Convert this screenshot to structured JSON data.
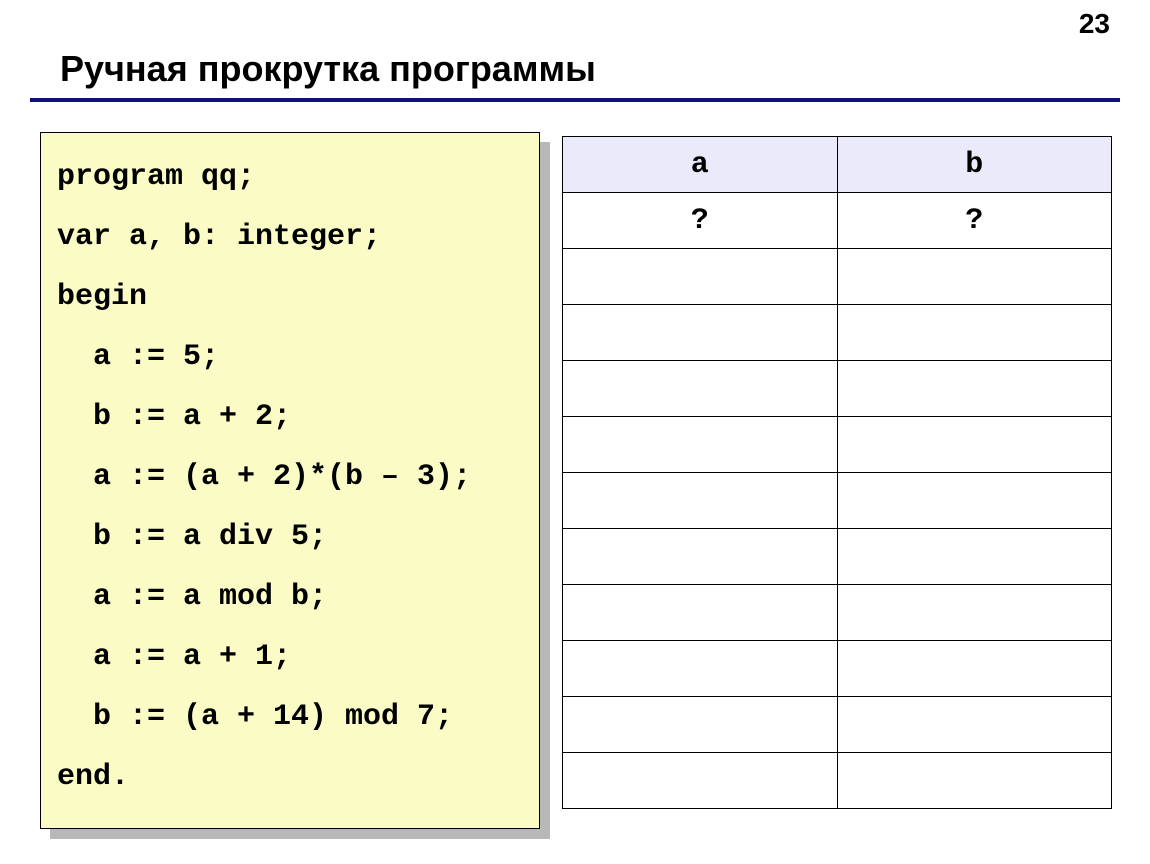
{
  "page_number": "23",
  "title": "Ручная прокрутка программы",
  "code": {
    "lines": [
      "program qq;",
      "var a, b: integer;",
      "begin",
      "  a := 5;",
      "  b := a + 2;",
      "  a := (a + 2)*(b – 3);",
      "  b := a div 5;",
      "  a := a mod b;",
      "  a := a + 1;",
      "  b := (a + 14) mod 7;",
      "end."
    ]
  },
  "table": {
    "headers": [
      "a",
      "b"
    ],
    "rows": [
      [
        "?",
        "?"
      ],
      [
        "",
        ""
      ],
      [
        "",
        ""
      ],
      [
        "",
        ""
      ],
      [
        "",
        ""
      ],
      [
        "",
        ""
      ],
      [
        "",
        ""
      ],
      [
        "",
        ""
      ],
      [
        "",
        ""
      ],
      [
        "",
        ""
      ],
      [
        "",
        ""
      ]
    ]
  }
}
